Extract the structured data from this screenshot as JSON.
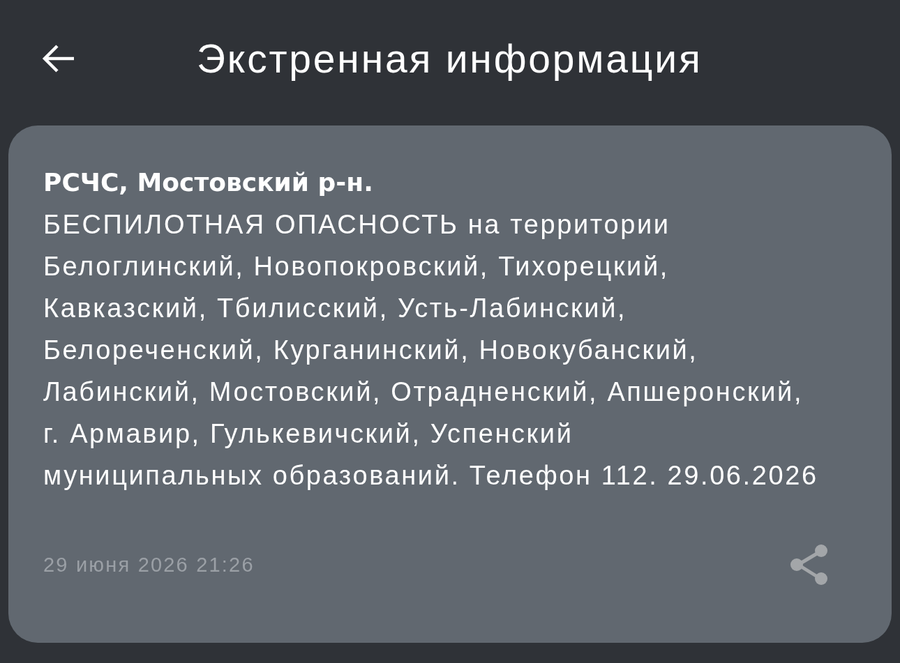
{
  "header": {
    "title": "Экстренная информация"
  },
  "alerts": [
    {
      "source": "РСЧС, Мостовский р-н.",
      "message": "БЕСПИЛОТНАЯ ОПАСНОСТЬ на территории\nБелоглинский, Новопокровский, Тихорецкий,\nКавказский, Тбилисский, Усть-Лабинский,\nБелореченский, Курганинский, Новокубанский,\nЛабинский, Мостовский, Отрадненский, Апшеронский,\nг. Армавир, Гулькевичский, Успенский\nмуниципальных образований. Телефон 112. 29.06.2026",
      "timestamp": "29 июня 2026 21:26"
    }
  ]
}
